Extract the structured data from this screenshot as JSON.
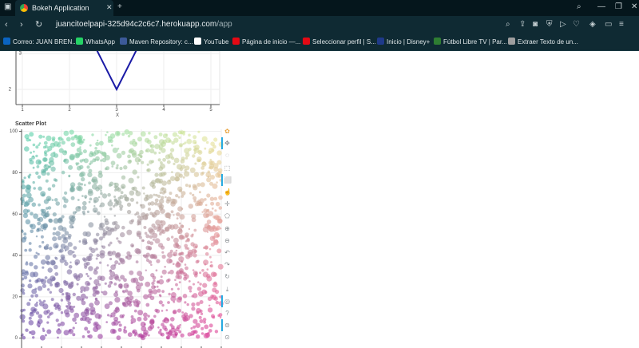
{
  "browser": {
    "tab_title": "Bokeh Application",
    "new_tab": "+",
    "url_host": "juancitoelpapi-325d94c2c6c7.herokuapp.com",
    "url_path": "/app",
    "bookmarks": [
      {
        "label": "Correo: JUAN BREN...",
        "color": "#0a64c2"
      },
      {
        "label": "WhatsApp",
        "color": "#25d366"
      },
      {
        "label": "Maven Repository: c...",
        "color": "#3c5a99"
      },
      {
        "label": "YouTube",
        "color": "#ffffff"
      },
      {
        "label": "Página de inicio —...",
        "color": "#e50914"
      },
      {
        "label": "Seleccionar perfil | S...",
        "color": "#e50914"
      },
      {
        "label": "Inicio | Disney+",
        "color": "#1f3a8a"
      },
      {
        "label": "Fútbol Libre TV | Par...",
        "color": "#2e7d32"
      },
      {
        "label": "Extraer Texto de un...",
        "color": "#9e9e9e"
      }
    ]
  },
  "line_plot": {
    "xlabel": "X",
    "x_ticks": [
      "1",
      "2",
      "3",
      "4",
      "5"
    ],
    "y_ticks": [
      "3",
      "2"
    ],
    "line_color": "#1a1aa6"
  },
  "scatter_plot": {
    "title": "Scatter Plot",
    "y_ticks": [
      "100",
      "80",
      "60",
      "40",
      "20",
      "0"
    ]
  },
  "chart_data": [
    {
      "type": "line",
      "xlabel": "X",
      "ylabel": "",
      "x": [
        2.5,
        3,
        3.5
      ],
      "y": [
        3.3,
        2,
        3.3
      ],
      "xlim": [
        0.8,
        5.2
      ],
      "ylim": [
        1.7,
        3.3
      ],
      "grid": true
    },
    {
      "type": "scatter",
      "title": "Scatter Plot",
      "xlabel": "",
      "ylabel": "",
      "xlim": [
        0,
        100
      ],
      "ylim": [
        -4,
        101
      ],
      "point_count": 1400,
      "color_scheme": "x/y gradient: cyan-green top-left, yellow top-right, purple bottom-left, magenta bottom-right",
      "grid": true
    }
  ],
  "toolbar": {
    "tools": [
      "bokeh-logo-icon",
      "pan-icon",
      "lasso-select-icon",
      "box-zoom-icon",
      "box-select-icon",
      "tap-icon",
      "crosshair-icon",
      "poly-select-icon",
      "zoom-in-icon",
      "zoom-out-icon",
      "undo-icon",
      "redo-icon",
      "reset-icon",
      "save-icon",
      "wheel-zoom-icon",
      "help-icon",
      "hover-icon",
      "examine-icon"
    ]
  }
}
